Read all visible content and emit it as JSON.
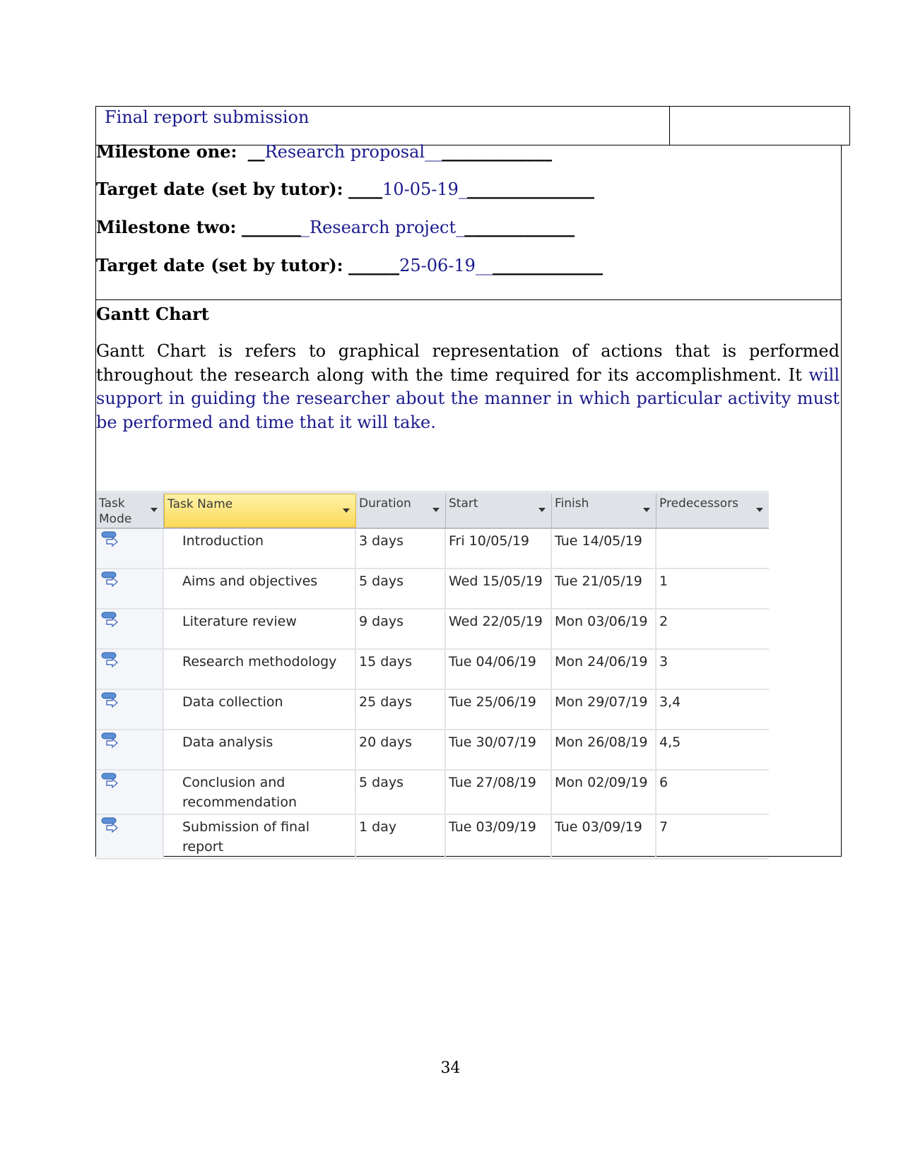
{
  "top_row": {
    "text": "Final report submission"
  },
  "milestones": [
    {
      "label": "Milestone one:",
      "pre": "__",
      "value": "Research proposal",
      "post": "__",
      "trail": "_____________"
    },
    {
      "label": "Target date (set by tutor):",
      "pre": "____",
      "value": "10-05-19",
      "post": "_",
      "trail": "_______________"
    },
    {
      "label": "Milestone two:",
      "pre": "_______",
      "value": "_Research project",
      "post": "_",
      "trail": "_____________"
    },
    {
      "label": "Target date (set by tutor):",
      "pre": "______",
      "value": "25-06-19",
      "post": "__",
      "trail": "_____________"
    }
  ],
  "gantt_section": {
    "title": "Gantt Chart",
    "para_black": "Gantt Chart is refers to graphical representation of actions that is performed throughout the research along with the time required for its accomplishment. It",
    "para_blue": "will support in guiding the researcher about the manner in which particular activity must be performed and time that it will take."
  },
  "table": {
    "headers": [
      "Task Mode",
      "Task Name",
      "Duration",
      "Start",
      "Finish",
      "Predecessors"
    ],
    "task_mode_icon": "auto-scheduled-task-icon",
    "rows": [
      {
        "name": "Introduction",
        "duration": "3 days",
        "start": "Fri 10/05/19",
        "finish": "Tue 14/05/19",
        "pred": ""
      },
      {
        "name": "Aims and objectives",
        "duration": "5 days",
        "start": "Wed 15/05/19",
        "finish": "Tue 21/05/19",
        "pred": "1"
      },
      {
        "name": "Literature review",
        "duration": "9 days",
        "start": "Wed 22/05/19",
        "finish": "Mon 03/06/19",
        "pred": "2"
      },
      {
        "name": "Research methodology",
        "duration": "15 days",
        "start": "Tue 04/06/19",
        "finish": "Mon 24/06/19",
        "pred": "3"
      },
      {
        "name": "Data collection",
        "duration": "25 days",
        "start": "Tue 25/06/19",
        "finish": "Mon 29/07/19",
        "pred": "3,4"
      },
      {
        "name": "Data analysis",
        "duration": "20 days",
        "start": "Tue 30/07/19",
        "finish": "Mon 26/08/19",
        "pred": "4,5"
      },
      {
        "name": "Conclusion and recommendation",
        "duration": "5 days",
        "start": "Tue 27/08/19",
        "finish": "Mon 02/09/19",
        "pred": "6"
      },
      {
        "name": "Submission of final report",
        "duration": "1 day",
        "start": "Tue 03/09/19",
        "finish": "Tue 03/09/19",
        "pred": "7"
      }
    ]
  },
  "footer": {
    "page_number": "34"
  },
  "colors": {
    "blue_text": "#1a1a8c",
    "header_highlight": "#fbd95a"
  }
}
